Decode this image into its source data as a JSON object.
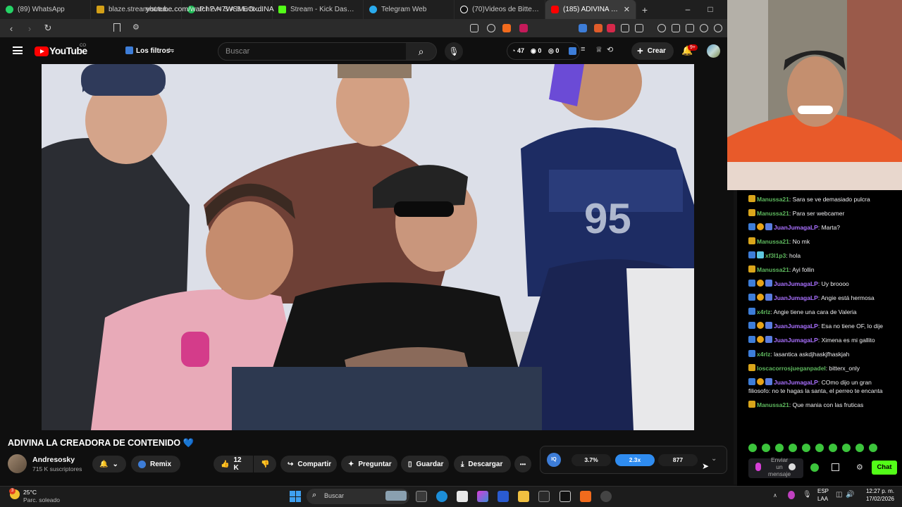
{
  "browser": {
    "tabs": [
      {
        "label": "(89) WhatsApp",
        "color": "#25d366"
      },
      {
        "label": "blaze.stream/stream-settings",
        "color": "#d4a017"
      },
      {
        "label": "P I E N S A S E N M I - C",
        "color": "#1db954"
      },
      {
        "label": "Stream - Kick Dashboard",
        "color": "#53fc18"
      },
      {
        "label": "Telegram Web",
        "color": "#2aabee"
      },
      {
        "label": "(70)Videos de Bitter 123 (@",
        "color": "#000000"
      },
      {
        "label": "(185) ADIVINA LA C",
        "color": "#ff0000",
        "active": true
      }
    ],
    "new_tab": "+",
    "url": "youtube.com/watch?v=7WSMuOxdINA",
    "window_controls": {
      "min": "–",
      "max": "□",
      "close": "✕"
    }
  },
  "youtube": {
    "logo_text": "YouTube",
    "logo_country": "CO",
    "filters_label": "Los filtros",
    "search_placeholder": "Buscar",
    "header_counts": {
      "a": "47",
      "b": "0",
      "c": "0"
    },
    "create_label": "Crear",
    "notif_badge": "9+",
    "video_title": "ADIVINA LA CREADORA DE CONTENIDO 💙",
    "channel_name": "Andresosky",
    "subscribers": "715 K suscriptores",
    "remix_label": "Remix",
    "likes": "12 K",
    "share_label": "Compartir",
    "ask_label": "Preguntar",
    "save_label": "Guardar",
    "download_label": "Descargar",
    "more_label": "•••",
    "stats": {
      "logo": "IQ",
      "percent": "3.7%",
      "ratio": "2.3x",
      "count": "877"
    }
  },
  "chat": {
    "messages": [
      {
        "user": "Manussa21",
        "color": "#5eb85e",
        "text": "Sara se ve demasiado pulcra",
        "badges": [
          "#d9a51b"
        ]
      },
      {
        "user": "Manussa21",
        "color": "#5eb85e",
        "text": "Para ser webcamer",
        "badges": [
          "#d9a51b"
        ]
      },
      {
        "user": "JuanJumagaLP",
        "color": "#a970ff",
        "text": "Marta?",
        "badges": [
          "#3d7dd8",
          "#e8a317",
          "#5a7de0"
        ]
      },
      {
        "user": "Manussa21",
        "color": "#5eb85e",
        "text": "No mk",
        "badges": [
          "#d9a51b"
        ]
      },
      {
        "user": "xf3l1p3",
        "color": "#5eb85e",
        "text": "hola",
        "badges": [
          "#3d7dd8",
          "#5ec8e0"
        ]
      },
      {
        "user": "Manussa21",
        "color": "#5eb85e",
        "text": "Ayi follin",
        "badges": [
          "#d9a51b"
        ]
      },
      {
        "user": "JuanJumagaLP",
        "color": "#a970ff",
        "text": "Uy broooo",
        "badges": [
          "#3d7dd8",
          "#e8a317",
          "#5a7de0"
        ]
      },
      {
        "user": "JuanJumagaLP",
        "color": "#a970ff",
        "text": "Angie está hermosa",
        "badges": [
          "#3d7dd8",
          "#e8a317",
          "#5a7de0"
        ]
      },
      {
        "user": "x4rlz",
        "color": "#5eb85e",
        "text": "Angie tiene una cara de Valeria",
        "badges": [
          "#3d7dd8"
        ]
      },
      {
        "user": "JuanJumagaLP",
        "color": "#a970ff",
        "text": "Esa no tiene OF, lo dije",
        "badges": [
          "#3d7dd8",
          "#e8a317",
          "#5a7de0"
        ]
      },
      {
        "user": "JuanJumagaLP",
        "color": "#a970ff",
        "text": "Ximena es mi gallito",
        "badges": [
          "#3d7dd8",
          "#e8a317",
          "#5a7de0"
        ]
      },
      {
        "user": "x4rlz",
        "color": "#5eb85e",
        "text": "lasantica askdjhaskjfhaskjah",
        "badges": [
          "#3d7dd8"
        ]
      },
      {
        "user": "loscacorrosjueganpadel",
        "color": "#5eb85e",
        "text": "bitterx_only",
        "badges": [
          "#d9a51b"
        ]
      },
      {
        "user": "JuanJumagaLP",
        "color": "#a970ff",
        "text": "COmo dijo un gran filiosofo: no te hagas la santa, el perreo te encanta",
        "badges": [
          "#3d7dd8",
          "#e8a317",
          "#5a7de0"
        ]
      },
      {
        "user": "Manussa21",
        "color": "#5eb85e",
        "text": "Que mania con las fruticas",
        "badges": [
          "#d9a51b"
        ]
      }
    ],
    "input_placeholder": "Enviar un mensaje",
    "chat_button": "Chat",
    "emotes": [
      "🟢",
      "🟢",
      "🟢",
      "🟢",
      "🟢",
      "🟢",
      "🟢",
      "🟢",
      "🟢",
      "🟢"
    ]
  },
  "taskbar": {
    "weather_temp": "25°C",
    "weather_desc": "Parc. soleado",
    "weather_badge": "3",
    "search_label": "Buscar",
    "lang": "ESP",
    "lang2": "LAA",
    "time": "12:27 p. m.",
    "date": "17/02/2026"
  }
}
